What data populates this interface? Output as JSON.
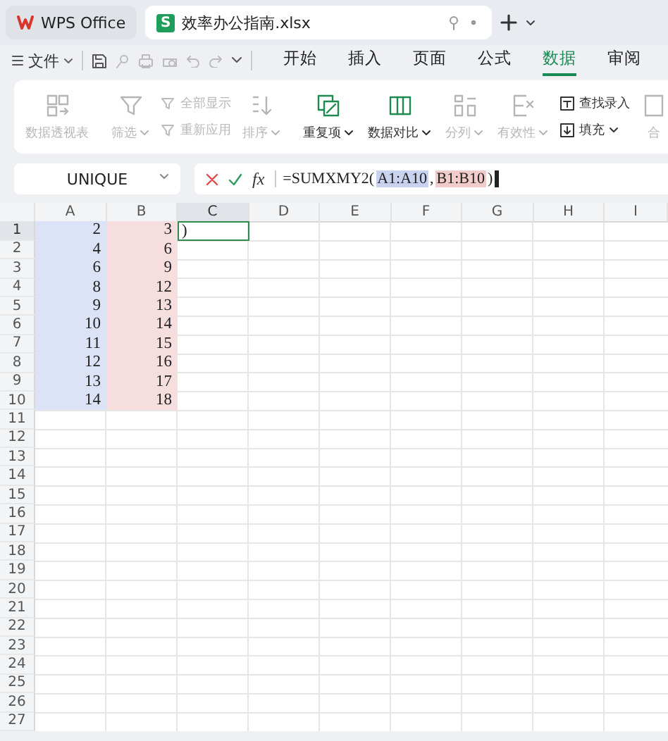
{
  "tabs": [
    {
      "kind": "home",
      "label": "WPS Office",
      "selected": false
    },
    {
      "kind": "doc",
      "badge": "S",
      "label": "效率办公指南.xlsx",
      "selected": true
    }
  ],
  "menu": {
    "file": "文件",
    "tabs": [
      {
        "label": "开始",
        "selected": false
      },
      {
        "label": "插入",
        "selected": false
      },
      {
        "label": "页面",
        "selected": false
      },
      {
        "label": "公式",
        "selected": false
      },
      {
        "label": "数据",
        "selected": true
      },
      {
        "label": "审阅",
        "selected": false
      }
    ]
  },
  "ribbon": [
    {
      "kind": "large",
      "label": "数据透视表",
      "disabled": true,
      "dropdown": false
    },
    {
      "kind": "sep"
    },
    {
      "kind": "large",
      "label": "筛选",
      "disabled": true,
      "dropdown": true
    },
    {
      "kind": "pair",
      "items": [
        {
          "label": "全部显示",
          "disabled": true,
          "dropdown": false
        },
        {
          "label": "重新应用",
          "disabled": true,
          "dropdown": false
        }
      ]
    },
    {
      "kind": "large",
      "label": "排序",
      "disabled": true,
      "dropdown": true
    },
    {
      "kind": "sep"
    },
    {
      "kind": "large",
      "label": "重复项",
      "disabled": false,
      "dropdown": true
    },
    {
      "kind": "large",
      "label": "数据对比",
      "disabled": false,
      "dropdown": true
    },
    {
      "kind": "large",
      "label": "分列",
      "disabled": true,
      "dropdown": true
    },
    {
      "kind": "large",
      "label": "有效性",
      "disabled": true,
      "dropdown": true
    },
    {
      "kind": "pair",
      "items": [
        {
          "label": "查找录入",
          "disabled": false,
          "dropdown": false
        },
        {
          "label": "填充",
          "disabled": false,
          "dropdown": true
        }
      ]
    },
    {
      "kind": "large",
      "label": "合",
      "disabled": true,
      "dropdown": false
    }
  ],
  "name_box": "UNIQUE",
  "fx_label": "fx",
  "formula": [
    {
      "text": "=SUMXMY2("
    },
    {
      "text": "A1:A10",
      "color": "#c9d3f0"
    },
    {
      "text": ","
    },
    {
      "text": "B1:B10",
      "color": "#f2cccc"
    },
    {
      "text": ")"
    }
  ],
  "columns": [
    {
      "label": "A",
      "selected": false,
      "color": "#dde3f6"
    },
    {
      "label": "B",
      "selected": false,
      "color": "#f7dede"
    },
    {
      "label": "C",
      "selected": true
    },
    {
      "label": "D",
      "selected": false
    },
    {
      "label": "E",
      "selected": false
    },
    {
      "label": "F",
      "selected": false
    },
    {
      "label": "G",
      "selected": false
    },
    {
      "label": "H",
      "selected": false
    },
    {
      "label": "I",
      "selected": false
    }
  ],
  "rows": [
    {
      "label": "1",
      "selected": true,
      "cells": [
        "2",
        "3",
        ")"
      ]
    },
    {
      "label": "2",
      "selected": false,
      "cells": [
        "4",
        "6"
      ]
    },
    {
      "label": "3",
      "selected": false,
      "cells": [
        "6",
        "9"
      ]
    },
    {
      "label": "4",
      "selected": false,
      "cells": [
        "8",
        "12"
      ]
    },
    {
      "label": "5",
      "selected": false,
      "cells": [
        "9",
        "13"
      ]
    },
    {
      "label": "6",
      "selected": false,
      "cells": [
        "10",
        "14"
      ]
    },
    {
      "label": "7",
      "selected": false,
      "cells": [
        "11",
        "15"
      ]
    },
    {
      "label": "8",
      "selected": false,
      "cells": [
        "12",
        "16"
      ]
    },
    {
      "label": "9",
      "selected": false,
      "cells": [
        "13",
        "17"
      ]
    },
    {
      "label": "10",
      "selected": false,
      "cells": [
        "14",
        "18"
      ]
    },
    {
      "label": "11",
      "selected": false,
      "cells": []
    },
    {
      "label": "12",
      "selected": false,
      "cells": []
    },
    {
      "label": "13",
      "selected": false,
      "cells": []
    },
    {
      "label": "14",
      "selected": false,
      "cells": []
    },
    {
      "label": "15",
      "selected": false,
      "cells": []
    },
    {
      "label": "16",
      "selected": false,
      "cells": []
    },
    {
      "label": "17",
      "selected": false,
      "cells": []
    },
    {
      "label": "18",
      "selected": false,
      "cells": []
    },
    {
      "label": "19",
      "selected": false,
      "cells": []
    },
    {
      "label": "20",
      "selected": false,
      "cells": []
    },
    {
      "label": "21",
      "selected": false,
      "cells": []
    },
    {
      "label": "22",
      "selected": false,
      "cells": []
    },
    {
      "label": "23",
      "selected": false,
      "cells": []
    },
    {
      "label": "24",
      "selected": false,
      "cells": []
    },
    {
      "label": "25",
      "selected": false,
      "cells": []
    },
    {
      "label": "26",
      "selected": false,
      "cells": []
    },
    {
      "label": "27",
      "selected": false,
      "cells": []
    }
  ]
}
